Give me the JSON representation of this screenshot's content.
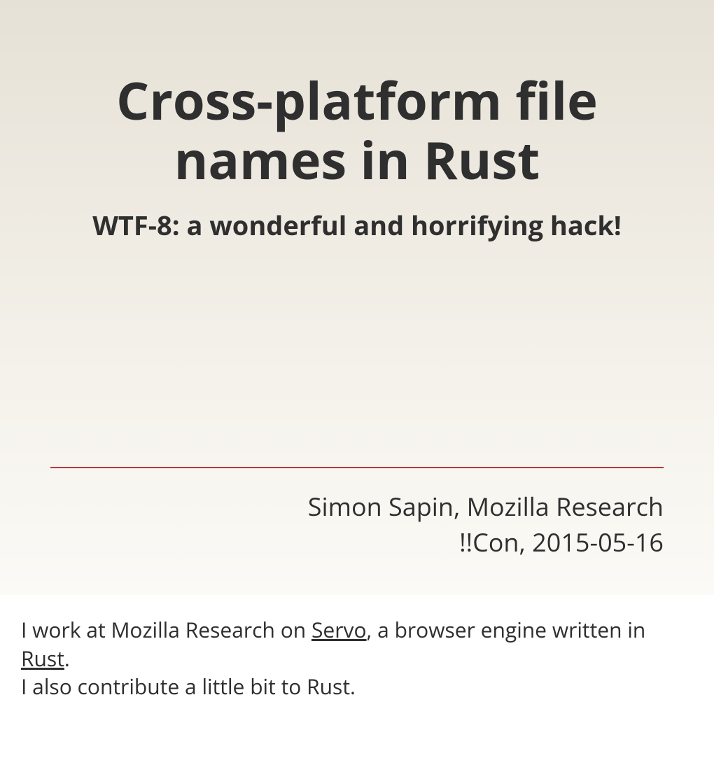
{
  "slide": {
    "title": "Cross-platform file names in Rust",
    "subtitle": "WTF-8: a wonderful and horrifying hack!",
    "author_line": "Simon Sapin, Mozilla Research",
    "event_line": "!!Con, 2015-05-16"
  },
  "notes": {
    "line1_pre": "I work at Mozilla Research on ",
    "link1": "Servo",
    "line1_mid": ", a browser engine written in ",
    "link2": "Rust",
    "line1_post": ".",
    "line2": "I also contribute a little bit to Rust."
  }
}
